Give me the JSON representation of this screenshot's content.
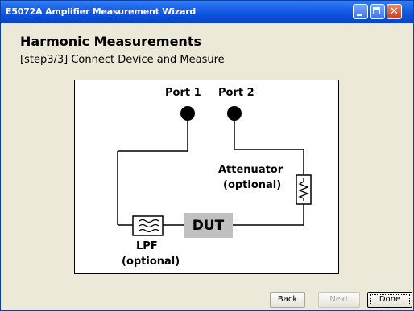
{
  "window": {
    "title": "E5072A Amplifier Measurement Wizard",
    "controls": [
      "minimize-icon",
      "maximize-icon",
      "close-icon"
    ]
  },
  "page": {
    "heading": "Harmonic Measurements",
    "subheading": "[step3/3] Connect Device and Measure"
  },
  "diagram": {
    "port1": "Port 1",
    "port2": "Port 2",
    "attenuator": "Attenuator",
    "attenuator_note": "(optional)",
    "dut": "DUT",
    "lpf": "LPF",
    "lpf_note": "(optional)"
  },
  "buttons": {
    "back": "Back",
    "next": "Next",
    "done": "Done"
  },
  "colors": {
    "titlebar": "#0b4fd8",
    "dut_box": "#c0c0c0"
  }
}
